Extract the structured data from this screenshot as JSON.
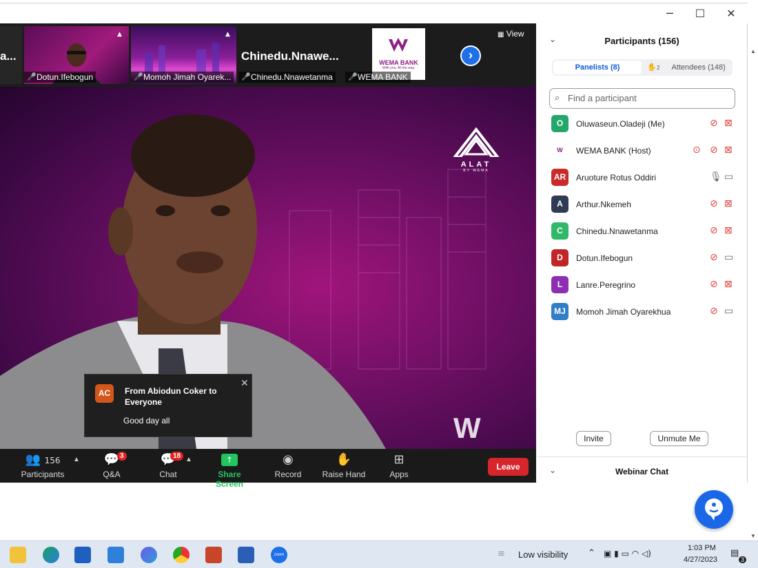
{
  "window_controls": {
    "minimize": "─",
    "maximize": "☐",
    "close": "✕"
  },
  "thumbs": {
    "partial_name": "a...",
    "items": [
      {
        "label": "Dotun.Ifebogun"
      },
      {
        "label": "Momoh Jimah Oyarek..."
      },
      {
        "label": "Chinedu.Nnawetanma",
        "tile_name": "Chinedu.Nnawe..."
      },
      {
        "label": "WEMA BANK",
        "logo_text": "WEMA BANK",
        "logo_tagline": "With you. All the way."
      }
    ],
    "view_label": "View",
    "next_arrow": "›"
  },
  "main_video": {
    "brand_mark": "ALAT",
    "brand_sub": "BY WEMA",
    "watermark": "W"
  },
  "toast": {
    "avatar": "AC",
    "from": "From Abiodun Coker to Everyone",
    "message": "Good day all",
    "close": "✕"
  },
  "toolbar": {
    "participants_label": "Participants",
    "participants_count": "156",
    "qa_label": "Q&A",
    "qa_badge": "3",
    "chat_label": "Chat",
    "chat_badge": "18",
    "share_label": "Share Screen",
    "record_label": "Record",
    "raise_label": "Raise Hand",
    "apps_label": "Apps",
    "leave_label": "Leave",
    "share_color": "#22c55e"
  },
  "panel": {
    "title": "Participants (156)",
    "tab_panelists": "Panelists (8)",
    "tab_attendees": "Attendees (148)",
    "raised_count": "2",
    "search_placeholder": "Find a participant",
    "participants": [
      {
        "initials": "O",
        "name": "Oluwaseun.Oladeji (Me)",
        "color": "#23a76b",
        "mic": "muted",
        "video": "off"
      },
      {
        "initials": "",
        "name": "WEMA BANK (Host)",
        "color": "#ffffff",
        "mic": "muted",
        "video": "off",
        "recording": true
      },
      {
        "initials": "AR",
        "name": "Aruoture Rotus Oddiri",
        "color": "#c92b2b",
        "mic": "on",
        "video": "on"
      },
      {
        "initials": "A",
        "name": "Arthur.Nkemeh",
        "color": "#2e3b55",
        "mic": "muted",
        "video": "off"
      },
      {
        "initials": "C",
        "name": "Chinedu.Nnawetanma",
        "color": "#2fb86a",
        "mic": "muted",
        "video": "off"
      },
      {
        "initials": "D",
        "name": "Dotun.Ifebogun",
        "color": "#c02626",
        "mic": "muted",
        "video": "on"
      },
      {
        "initials": "L",
        "name": "Lanre.Peregrino",
        "color": "#8e2fb3",
        "mic": "muted",
        "video": "off"
      },
      {
        "initials": "MJ",
        "name": "Momoh Jimah Oyarekhua",
        "color": "#2f7ec7",
        "mic": "muted",
        "video": "on"
      }
    ],
    "invite_label": "Invite",
    "unmute_label": "Unmute Me",
    "chat_title": "Webinar Chat"
  },
  "taskbar": {
    "weather": "Low visibility",
    "time": "1:03 PM",
    "date": "4/27/2023",
    "notif_count": "3",
    "zoom_label": "zoom"
  }
}
